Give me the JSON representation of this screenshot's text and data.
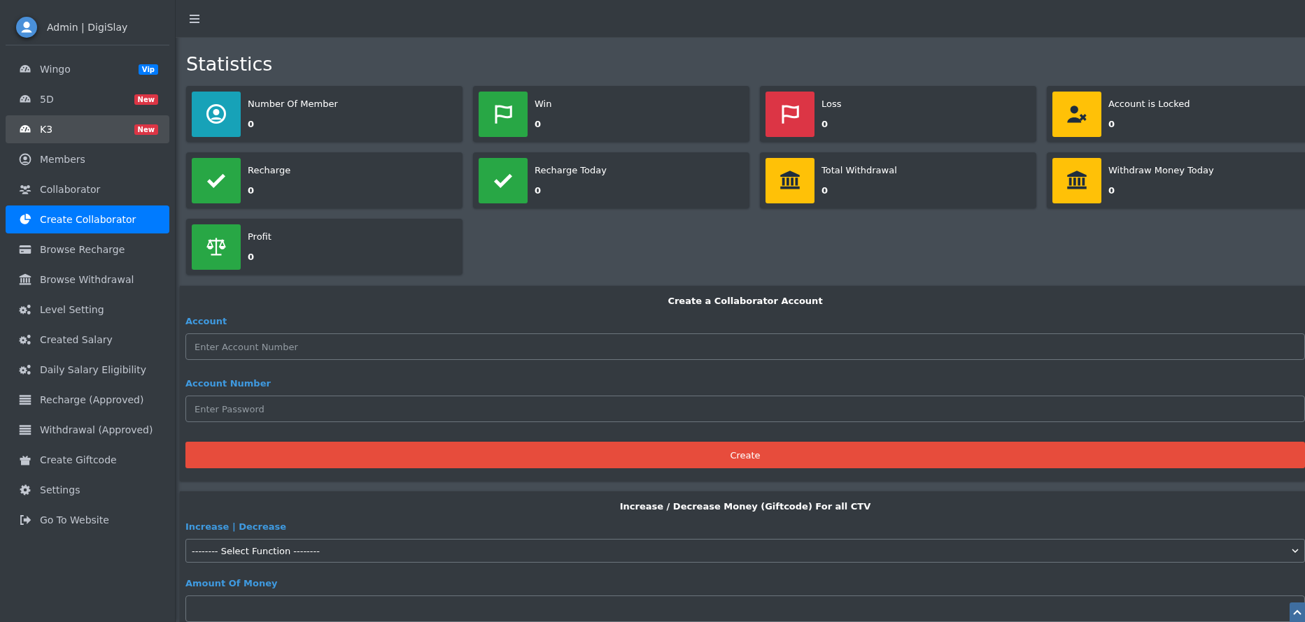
{
  "sidebar": {
    "brand": "Admin | DigiSlay",
    "items": [
      {
        "label": "Wingo",
        "kind": "gauge",
        "badge": {
          "text": "Vip",
          "color": "#007bff"
        },
        "selected": false,
        "hovered": false
      },
      {
        "label": "5D",
        "kind": "gauge",
        "badge": {
          "text": "New",
          "color": "#dc3545"
        },
        "selected": false,
        "hovered": false
      },
      {
        "label": "K3",
        "kind": "gauge",
        "badge": {
          "text": "New",
          "color": "#dc3545"
        },
        "selected": false,
        "hovered": true
      },
      {
        "label": "Members",
        "kind": "user",
        "selected": false,
        "hovered": false
      },
      {
        "label": "Collaborator",
        "kind": "users",
        "selected": false,
        "hovered": false
      },
      {
        "label": "Create Collaborator",
        "kind": "pie",
        "selected": true,
        "hovered": false
      },
      {
        "label": "Browse Recharge",
        "kind": "card",
        "selected": false,
        "hovered": false
      },
      {
        "label": "Browse Withdrawal",
        "kind": "bank",
        "selected": false,
        "hovered": false
      },
      {
        "label": "Level Setting",
        "kind": "gears",
        "selected": false,
        "hovered": false
      },
      {
        "label": "Created Salary",
        "kind": "gears",
        "selected": false,
        "hovered": false
      },
      {
        "label": "Daily Salary Eligibility",
        "kind": "gears",
        "selected": false,
        "hovered": false
      },
      {
        "label": "Recharge (Approved)",
        "kind": "list",
        "selected": false,
        "hovered": false
      },
      {
        "label": "Withdrawal (Approved)",
        "kind": "list",
        "selected": false,
        "hovered": false
      },
      {
        "label": "Create Giftcode",
        "kind": "gift",
        "selected": false,
        "hovered": false
      },
      {
        "label": "Settings",
        "kind": "gear",
        "selected": false,
        "hovered": false
      },
      {
        "label": "Go To Website",
        "kind": "exit",
        "selected": false,
        "hovered": false
      }
    ]
  },
  "page_title": "Statistics",
  "stats": [
    {
      "label": "Number Of Member",
      "value": "0",
      "kind": "user",
      "color": "#17a2b8"
    },
    {
      "label": "Win",
      "value": "0",
      "kind": "flag",
      "color": "#28a745"
    },
    {
      "label": "Loss",
      "value": "0",
      "kind": "flag",
      "color": "#dc3545"
    },
    {
      "label": "Account is Locked",
      "value": "0",
      "kind": "userx",
      "color": "#ffc107"
    },
    {
      "label": "Recharge",
      "value": "0",
      "kind": "check",
      "color": "#28a745"
    },
    {
      "label": "Recharge Today",
      "value": "0",
      "kind": "check",
      "color": "#28a745"
    },
    {
      "label": "Total Withdrawal",
      "value": "0",
      "kind": "bank",
      "color": "#ffc107"
    },
    {
      "label": "Withdraw Money Today",
      "value": "0",
      "kind": "bank",
      "color": "#ffc107"
    },
    {
      "label": "Profit",
      "value": "0",
      "kind": "scale",
      "color": "#28a745"
    }
  ],
  "collaborator_form": {
    "title": "Create a Collaborator Account",
    "fields": [
      {
        "label": "Account",
        "placeholder": "Enter Account Number"
      },
      {
        "label": "Account Number",
        "placeholder": "Enter Password"
      }
    ],
    "button": "Create"
  },
  "giftcode_form": {
    "title": "Increase / Decrease Money (Giftcode) For all CTV",
    "function_label": "Increase | Decrease",
    "function_value": "-------- Select Function --------",
    "amount_label": "Amount Of Money"
  }
}
